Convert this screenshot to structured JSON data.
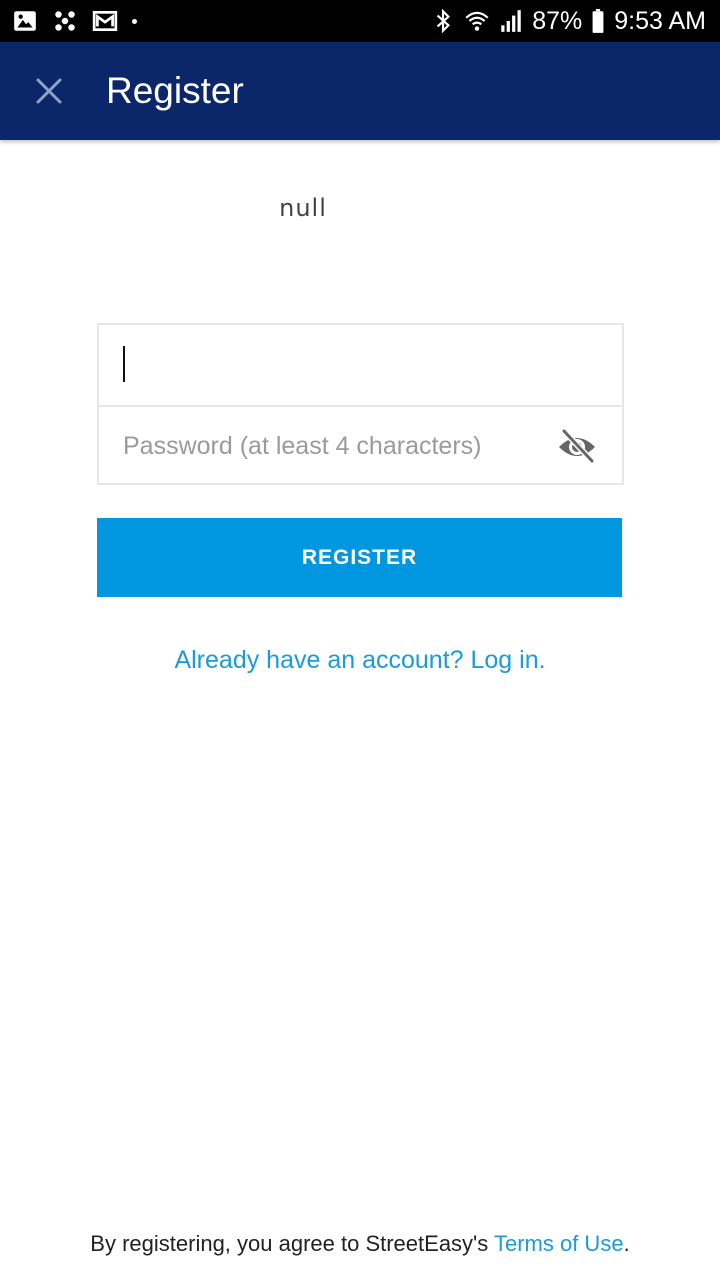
{
  "status_bar": {
    "battery": "87%",
    "time": "9:53 AM",
    "icons_left": [
      "gallery-icon",
      "pinwheel-icon",
      "gmail-icon",
      "dot-icon"
    ],
    "icons_right": [
      "bluetooth-icon",
      "wifi-icon",
      "signal-icon",
      "battery-icon"
    ]
  },
  "app_bar": {
    "title": "Register",
    "close_icon": "close-icon",
    "background": "#0b2669"
  },
  "header_text": "null",
  "form": {
    "email_value": "",
    "email_placeholder": "",
    "password_value": "",
    "password_placeholder": "Password (at least 4 characters)",
    "password_visibility_icon": "eye-off-icon"
  },
  "register_button": {
    "label": "REGISTER",
    "color": "#0096e0"
  },
  "login_link": "Already have an account? Log in.",
  "footer": {
    "prefix": "By registering, you agree to StreetEasy's ",
    "terms_link": "Terms of Use",
    "suffix": "."
  },
  "colors": {
    "link": "#1e9ad6",
    "accent": "#0096e0",
    "app_bar": "#0b2669"
  }
}
